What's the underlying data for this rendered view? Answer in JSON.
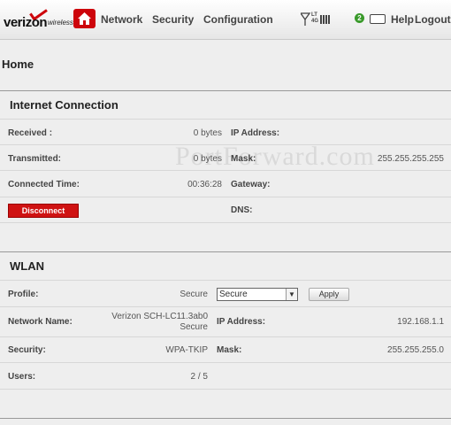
{
  "header": {
    "logo_text": "verizon",
    "logo_sub": "wireless",
    "nav": [
      "Network",
      "Security",
      "Configuration"
    ],
    "signal_label_top": "LT",
    "signal_label_bottom": "4G",
    "help_label": "Help",
    "logout_label": "Logout",
    "status_badge": "2"
  },
  "page": {
    "title": "Home"
  },
  "internet": {
    "title": "Internet Connection",
    "received_label": "Received :",
    "received_value": "0 bytes",
    "transmitted_label": "Transmitted:",
    "transmitted_value": "0 bytes",
    "connected_time_label": "Connected Time:",
    "connected_time_value": "00:36:28",
    "disconnect_label": "Disconnect",
    "ip_label": "IP Address:",
    "mask_label": "Mask:",
    "mask_value": "255.255.255.255",
    "gateway_label": "Gateway:",
    "dns_label": "DNS:"
  },
  "wlan": {
    "title": "WLAN",
    "profile_label": "Profile:",
    "profile_value": "Secure",
    "profile_select": "Secure",
    "apply_label": "Apply",
    "network_name_label": "Network Name:",
    "network_name_line1": "Verizon SCH-LC11.3ab0",
    "network_name_line2": "Secure",
    "ip_label": "IP Address:",
    "ip_value": "192.168.1.1",
    "security_label": "Security:",
    "security_value": "WPA-TKIP",
    "mask_label": "Mask:",
    "mask_value": "255.255.255.0",
    "users_label": "Users:",
    "users_value": "2 / 5"
  },
  "watermark": "PortForward.com",
  "colors": {
    "brand_red": "#cd040b",
    "background": "#eeeeee"
  },
  "icons": [
    "home-icon",
    "signal-icon",
    "battery-icon",
    "status-icon"
  ]
}
